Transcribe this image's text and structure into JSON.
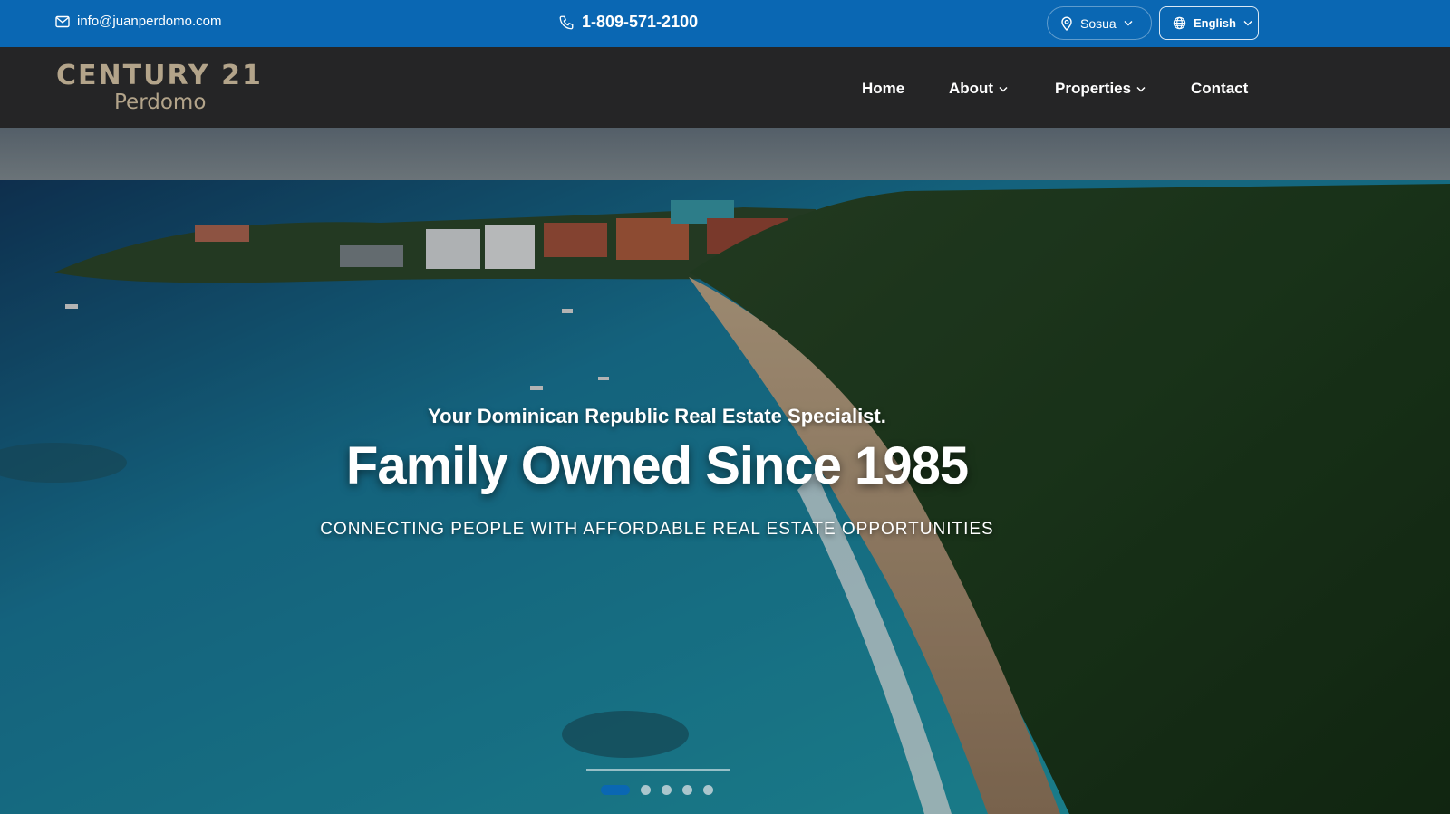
{
  "topbar": {
    "email": "info@juanperdomo.com",
    "phone": "1-809-571-2100",
    "location": "Sosua",
    "language": "English"
  },
  "logo": {
    "brand": "CENTURY 21",
    "sub": "Perdomo"
  },
  "nav": {
    "home": "Home",
    "about": "About",
    "properties": "Properties",
    "contact": "Contact"
  },
  "hero": {
    "subtitle": "Your Dominican Republic Real Estate Specialist.",
    "title": "Family Owned Since 1985",
    "tagline": "CONNECTING PEOPLE WITH AFFORDABLE REAL ESTATE OPPORTUNITIES",
    "slides_total": 5,
    "active_slide": 1
  },
  "colors": {
    "topbar": "#0a67b3",
    "navbar": "#252526",
    "logo": "#b3a48a",
    "accent": "#0a67b3"
  }
}
